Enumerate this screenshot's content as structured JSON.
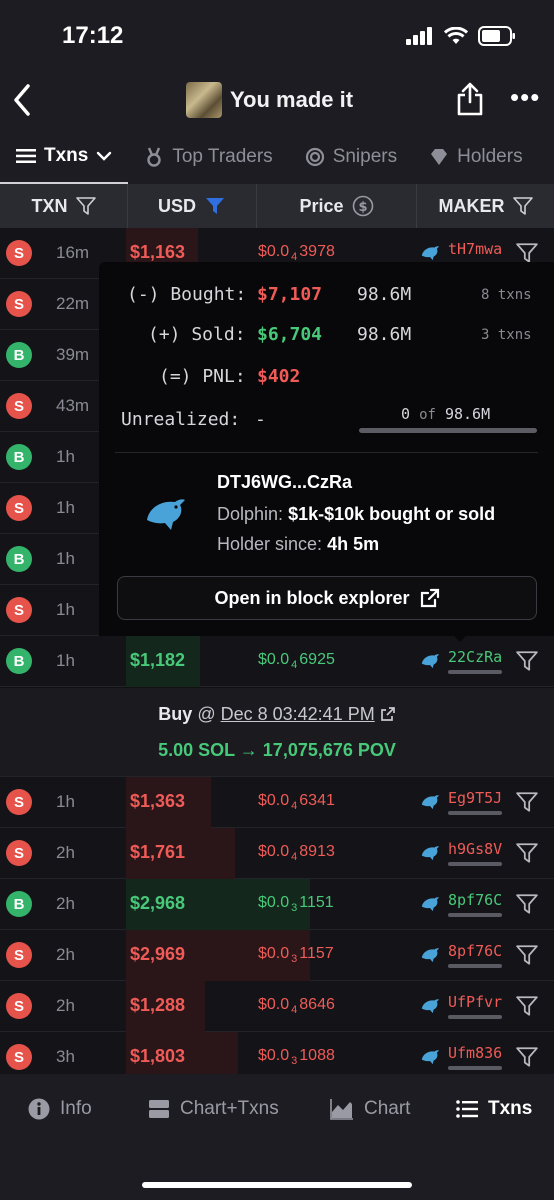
{
  "status_bar": {
    "time": "17:12"
  },
  "nav": {
    "title": "You made it"
  },
  "tabs": [
    {
      "label": "Txns",
      "icon": "list-icon",
      "active": true
    },
    {
      "label": "Top Traders",
      "icon": "medal-icon",
      "active": false
    },
    {
      "label": "Snipers",
      "icon": "target-icon",
      "active": false
    },
    {
      "label": "Holders",
      "icon": "diamond-icon",
      "active": false
    }
  ],
  "columns": {
    "txn": "TXN",
    "usd": "USD",
    "price": "Price",
    "maker": "MAKER"
  },
  "rows": [
    {
      "type": "S",
      "age": "16m",
      "usd": "$1,163",
      "price_a": "$0.0",
      "price_sub": "4",
      "price_b": "3978",
      "maker": "tH7mwa",
      "bar": 0.39
    },
    {
      "type": "S",
      "age": "22m",
      "usd": "",
      "price_a": "",
      "price_sub": "",
      "price_b": "",
      "maker": "",
      "bar": 0.3
    },
    {
      "type": "B",
      "age": "39m",
      "usd": "",
      "price_a": "",
      "price_sub": "",
      "price_b": "",
      "maker": "",
      "bar": 0.3
    },
    {
      "type": "S",
      "age": "43m",
      "usd": "",
      "price_a": "",
      "price_sub": "",
      "price_b": "",
      "maker": "",
      "bar": 0.3
    },
    {
      "type": "B",
      "age": "1h",
      "usd": "",
      "price_a": "",
      "price_sub": "",
      "price_b": "",
      "maker": "",
      "bar": 0.3
    },
    {
      "type": "S",
      "age": "1h",
      "usd": "",
      "price_a": "",
      "price_sub": "",
      "price_b": "",
      "maker": "",
      "bar": 0.3
    },
    {
      "type": "B",
      "age": "1h",
      "usd": "",
      "price_a": "",
      "price_sub": "",
      "price_b": "",
      "maker": "",
      "bar": 0.3
    },
    {
      "type": "S",
      "age": "1h",
      "usd": "",
      "price_a": "",
      "price_sub": "",
      "price_b": "",
      "maker": "",
      "bar": 0.3
    },
    {
      "type": "B",
      "age": "1h",
      "usd": "$1,182",
      "price_a": "$0.0",
      "price_sub": "4",
      "price_b": "6925",
      "maker": "22CzRa",
      "bar": 0.4
    }
  ],
  "detail": {
    "side": "Buy",
    "at": "@",
    "date": "Dec 8 03:42:41 PM",
    "amount": "5.00 SOL → 17,075,676 POV"
  },
  "rows2": [
    {
      "type": "S",
      "age": "1h",
      "usd": "$1,363",
      "price_a": "$0.0",
      "price_sub": "4",
      "price_b": "6341",
      "maker": "Eg9T5J",
      "bar": 0.46
    },
    {
      "type": "S",
      "age": "2h",
      "usd": "$1,761",
      "price_a": "$0.0",
      "price_sub": "4",
      "price_b": "8913",
      "maker": "h9Gs8V",
      "bar": 0.59
    },
    {
      "type": "B",
      "age": "2h",
      "usd": "$2,968",
      "price_a": "$0.0",
      "price_sub": "3",
      "price_b": "1151",
      "maker": "8pf76C",
      "bar": 1.0
    },
    {
      "type": "S",
      "age": "2h",
      "usd": "$2,969",
      "price_a": "$0.0",
      "price_sub": "3",
      "price_b": "1157",
      "maker": "8pf76C",
      "bar": 1.0
    },
    {
      "type": "S",
      "age": "2h",
      "usd": "$1,288",
      "price_a": "$0.0",
      "price_sub": "4",
      "price_b": "8646",
      "maker": "UfPfvr",
      "bar": 0.43
    },
    {
      "type": "S",
      "age": "3h",
      "usd": "$1,803",
      "price_a": "$0.0",
      "price_sub": "3",
      "price_b": "1088",
      "maker": "Ufm836",
      "bar": 0.61
    }
  ],
  "popover": {
    "bought_label": "(-) Bought:",
    "bought_usd": "$7,107",
    "bought_amt": "98.6M",
    "bought_txns": "8 txns",
    "sold_label": "(+) Sold:",
    "sold_usd": "$6,704",
    "sold_amt": "98.6M",
    "sold_txns": "3 txns",
    "pnl_label": "(=) PNL:",
    "pnl_usd": "$402",
    "unrealized_label": "Unrealized:",
    "unrealized_value": "-",
    "unrealized_held": "0",
    "unrealized_of": "of",
    "unrealized_total": "98.6M",
    "wallet": "DTJ6WG...CzRa",
    "tier_label": "Dolphin:",
    "tier_value": "$1k-$10k bought or sold",
    "holder_label": "Holder since:",
    "holder_value": "4h 5m",
    "explorer_button": "Open in block explorer"
  },
  "bottom_nav": [
    {
      "label": "Info",
      "icon": "info-icon",
      "active": false
    },
    {
      "label": "Chart+Txns",
      "icon": "chart-txns-icon",
      "active": false
    },
    {
      "label": "Chart",
      "icon": "area-chart-icon",
      "active": false
    },
    {
      "label": "Txns",
      "icon": "list-icon",
      "active": true
    }
  ],
  "colors": {
    "sell": "#ef5b57",
    "buy": "#48c979",
    "accent_filter": "#2f6fe0"
  }
}
